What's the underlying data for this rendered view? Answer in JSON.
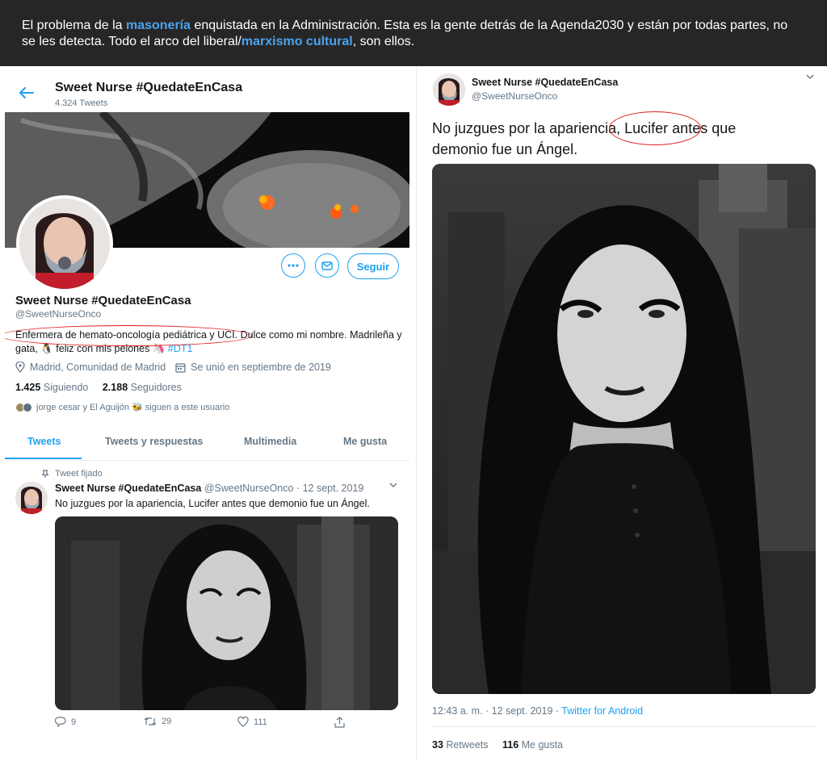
{
  "banner": {
    "p1": "El problema de la ",
    "h1": "masonería",
    "p2": " enquistada en la Administración. Esta es la gente detrás de la Agenda2030 y están por todas partes, no se les detecta. Todo el arco del liberal/",
    "h2": "marxismo cultural",
    "p3": ", son ellos.",
    "highlight_color": "#4aa3ef"
  },
  "profile": {
    "header_name": "Sweet Nurse #QuedateEnCasa",
    "tweet_count": "4.324 Tweets",
    "name": "Sweet Nurse #QuedateEnCasa",
    "handle": "@SweetNurseOnco",
    "bio_text": "Enfermera de hemato-oncología pediátrica y UCI. Dulce como mi nombre. Madrileña y gata, 🐧 feliz con mis pelones 🦄",
    "bio_tag": "#DT1",
    "location": "Madrid, Comunidad de Madrid",
    "joined": "Se unió en septiembre de 2019",
    "following_count": "1.425",
    "following_label": "Siguiendo",
    "followers_count": "2.188",
    "followers_label": "Seguidores",
    "followed_by": "jorge cesar y El Aguijón 🐝 siguen a este usuario",
    "follow_label": "Seguir",
    "more_icon": "more-icon",
    "message_icon": "envelope-icon"
  },
  "tabs": [
    "Tweets",
    "Tweets y respuestas",
    "Multimedia",
    "Me gusta"
  ],
  "pinned_tweet": {
    "pinned_label": "Tweet fijado",
    "name": "Sweet Nurse #QuedateEnCasa",
    "handle_date": "@SweetNurseOnco · 12 sept. 2019",
    "text": "No juzgues por la apariencia, Lucifer antes que demonio fue un Ángel.",
    "replies": "9",
    "retweets": "29",
    "likes": "111"
  },
  "main_tweet": {
    "name": "Sweet Nurse #QuedateEnCasa",
    "handle": "@SweetNurseOnco",
    "text": "No juzgues por la apariencia, Lucifer antes que demonio fue un Ángel.",
    "timestamp": "12:43 a. m. · 12 sept. 2019 · ",
    "source": "Twitter for Android",
    "retweets_count": "33",
    "retweets_label": "Retweets",
    "likes_count": "116",
    "likes_label": "Me gusta"
  },
  "colors": {
    "twitter_blue": "#1da1f2",
    "annotation_red": "#e0201f",
    "banner_bg": "#262626"
  }
}
